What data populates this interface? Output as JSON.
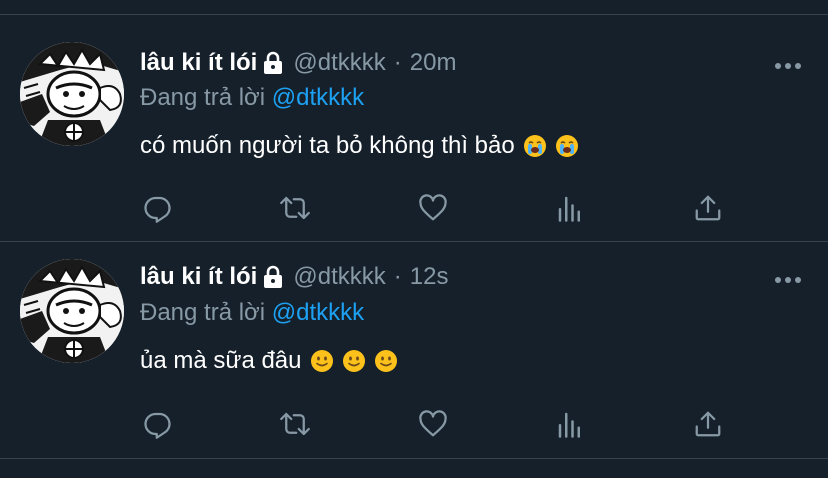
{
  "colors": {
    "background": "#15202b",
    "divider": "#38444d",
    "secondary_text": "#8899a6",
    "mention": "#1da1f2",
    "lock": "#ffffff"
  },
  "tweets": [
    {
      "name": "lâu ki ít lói",
      "handle": "@dtkkkk",
      "separator": "·",
      "time": "20m",
      "reply_prefix": "Đang trả lời",
      "reply_to": "@dtkkkk",
      "text": "có muốn người ta bỏ không thì bảo",
      "emojis": [
        "crying-face-emoji",
        "crying-face-emoji"
      ],
      "icons": {
        "lock": "lock-icon",
        "more": "more-icon",
        "reply": "reply-icon",
        "retweet": "retweet-icon",
        "like": "like-icon",
        "analytics": "analytics-icon",
        "share": "share-icon"
      }
    },
    {
      "name": "lâu ki ít lói",
      "handle": "@dtkkkk",
      "separator": "·",
      "time": "12s",
      "reply_prefix": "Đang trả lời",
      "reply_to": "@dtkkkk",
      "text": "ủa mà sữa đâu",
      "emojis": [
        "slightly-smiling-face-emoji",
        "slightly-smiling-face-emoji",
        "slightly-smiling-face-emoji"
      ],
      "icons": {
        "lock": "lock-icon",
        "more": "more-icon",
        "reply": "reply-icon",
        "retweet": "retweet-icon",
        "like": "like-icon",
        "analytics": "analytics-icon",
        "share": "share-icon"
      }
    }
  ]
}
